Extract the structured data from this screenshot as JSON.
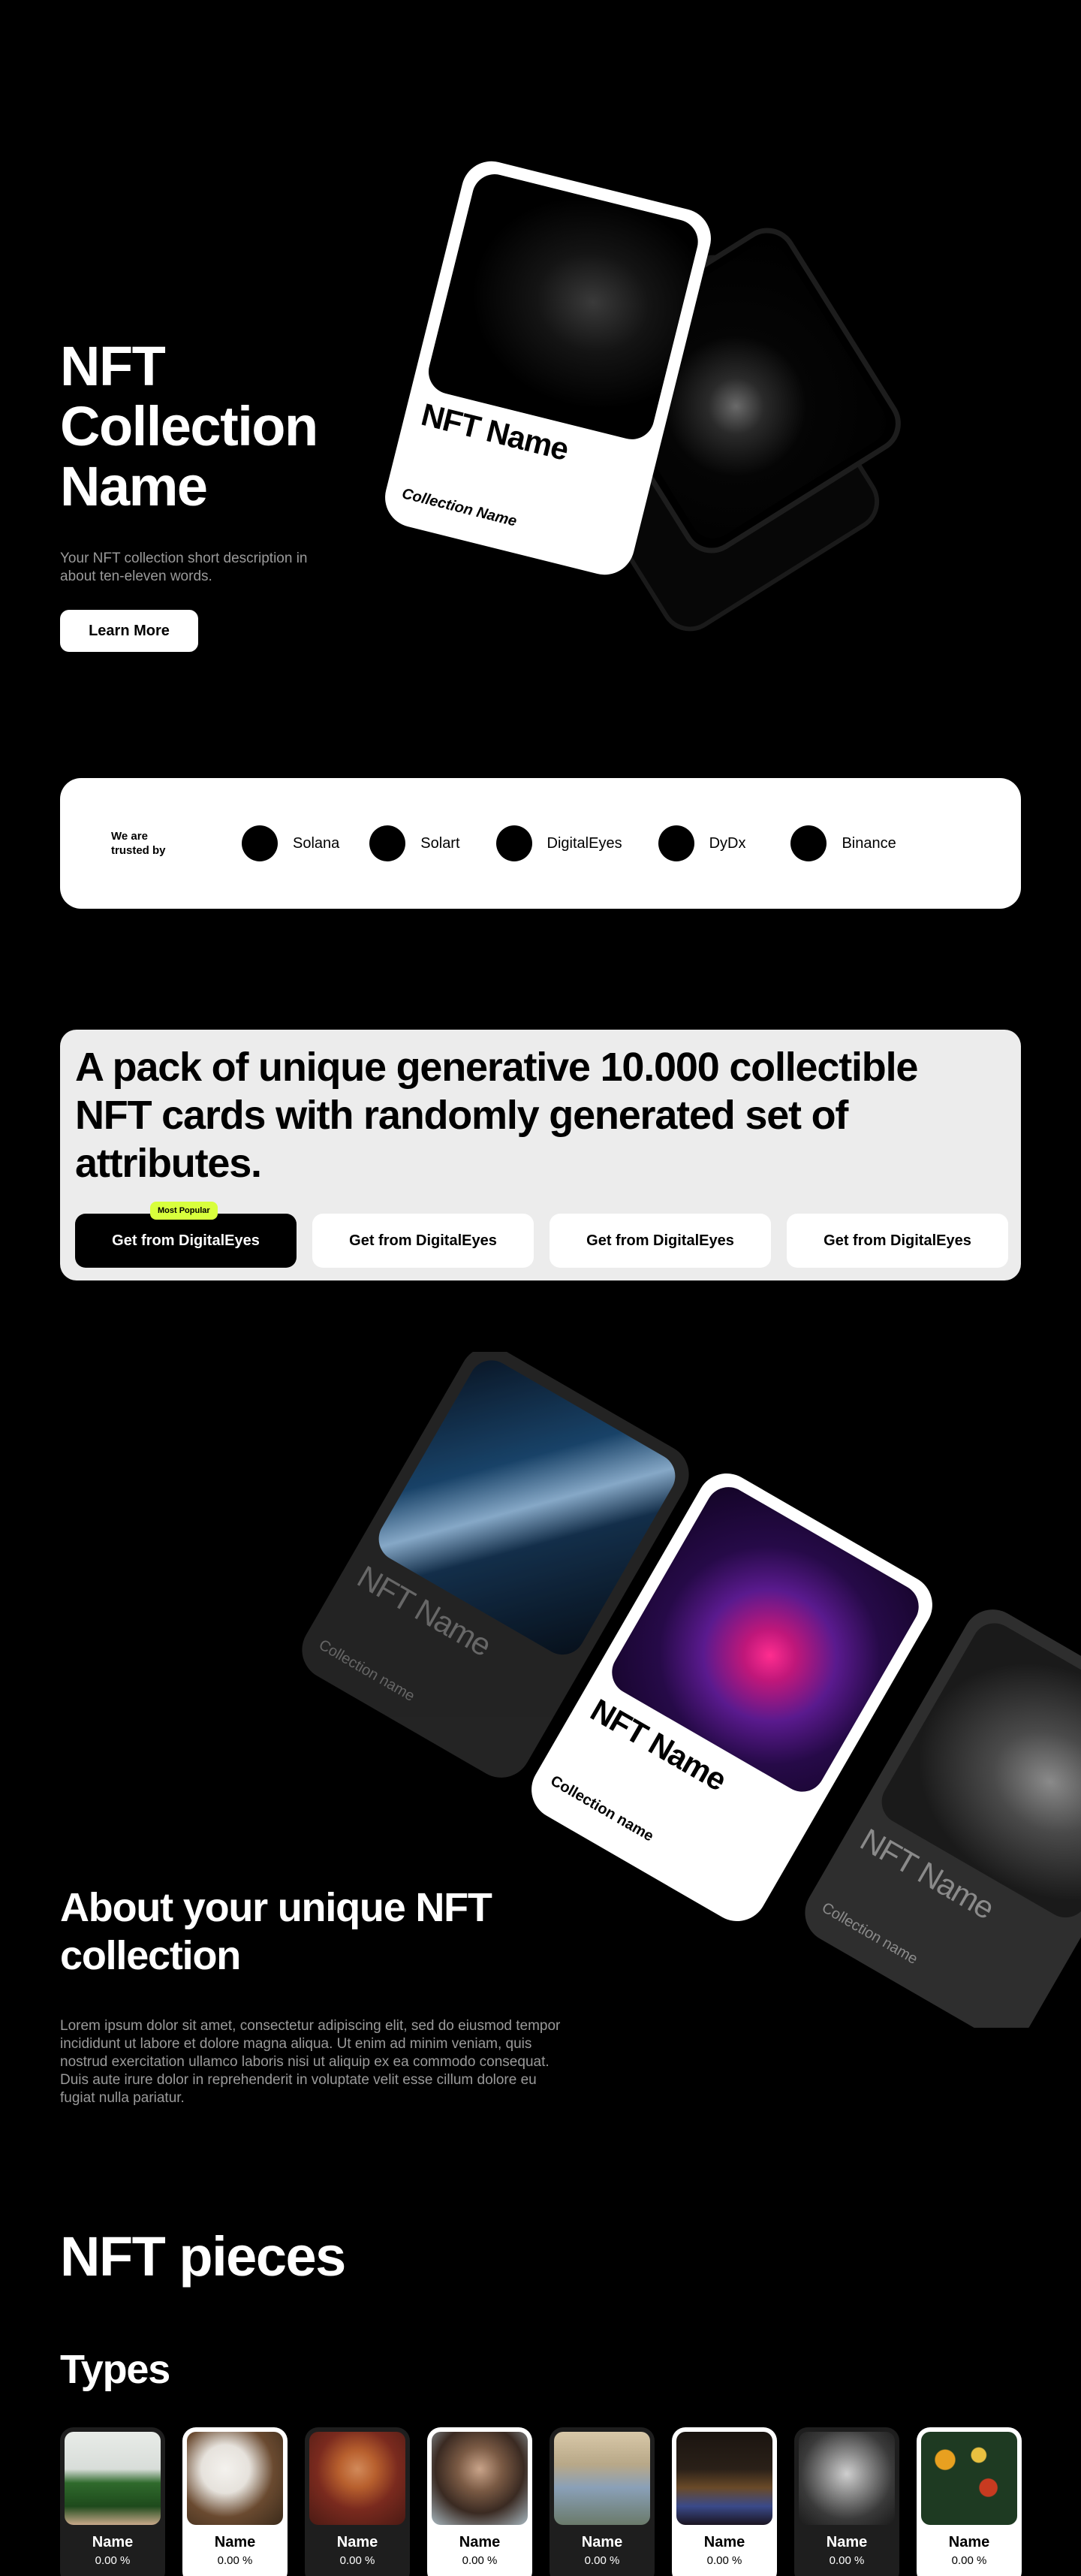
{
  "hero": {
    "title": "NFT Collection Name",
    "description": "Your NFT collection short description in about ten-eleven words.",
    "cta": "Learn More",
    "card_title": "NFT Name",
    "card_subtitle": "Collection Name"
  },
  "trusted": {
    "label": "We are trusted by",
    "partners": [
      "Solana",
      "Solart",
      "DigitalEyes",
      "DyDx",
      "Binance"
    ]
  },
  "pack": {
    "title": "A pack of unique generative 10.000 collectible NFT cards with randomly generated set of attributes.",
    "badge": "Most Popular",
    "buttons": [
      "Get from DigitalEyes",
      "Get from DigitalEyes",
      "Get from DigitalEyes",
      "Get from DigitalEyes"
    ]
  },
  "showcase": {
    "card_title": "NFT Name",
    "card_subtitle": "Collection name"
  },
  "about": {
    "title": "About your unique NFT collection",
    "body": "Lorem ipsum dolor sit amet, consectetur adipiscing elit, sed do eiusmod tempor incididunt ut labore et dolore magna aliqua. Ut enim ad minim veniam, quis nostrud exercitation ullamco laboris nisi ut aliquip ex ea commodo consequat. Duis aute irure dolor in reprehenderit in voluptate velit esse cillum dolore eu fugiat nulla pariatur."
  },
  "pieces": {
    "title": "NFT pieces",
    "types_title": "Types",
    "types": [
      {
        "name": "Name",
        "pct": "0.00 %",
        "theme": "dark"
      },
      {
        "name": "Name",
        "pct": "0.00 %",
        "theme": "light"
      },
      {
        "name": "Name",
        "pct": "0.00 %",
        "theme": "dark"
      },
      {
        "name": "Name",
        "pct": "0.00 %",
        "theme": "light"
      },
      {
        "name": "Name",
        "pct": "0.00 %",
        "theme": "dark"
      },
      {
        "name": "Name",
        "pct": "0.00 %",
        "theme": "light"
      },
      {
        "name": "Name",
        "pct": "0.00 %",
        "theme": "dark"
      },
      {
        "name": "Name",
        "pct": "0.00 %",
        "theme": "light"
      }
    ]
  },
  "colors": {
    "background": "#000000",
    "panel_light": "#ececec",
    "badge": "#d8ff3c",
    "muted_text": "#9a9a9a"
  }
}
